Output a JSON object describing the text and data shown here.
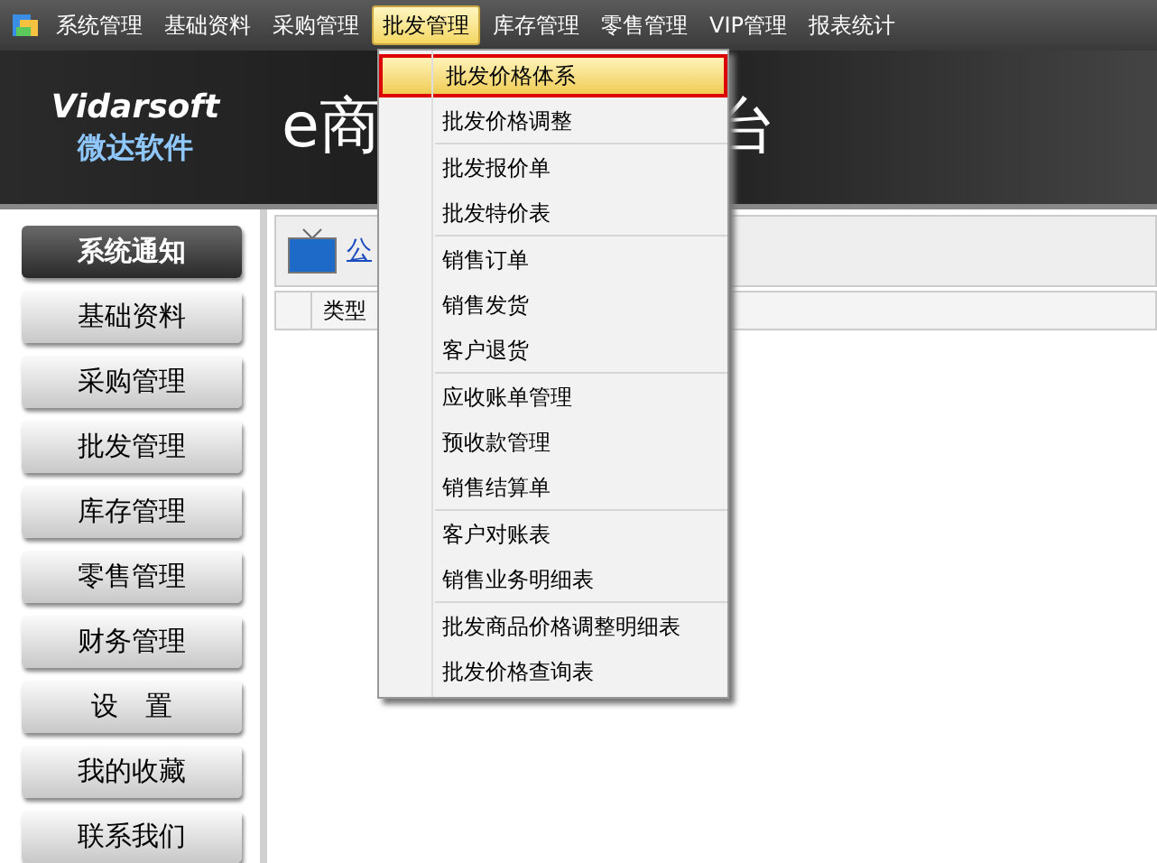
{
  "menubar": [
    {
      "label": "系统管理",
      "selected": false
    },
    {
      "label": "基础资料",
      "selected": false
    },
    {
      "label": "采购管理",
      "selected": false
    },
    {
      "label": "批发管理",
      "selected": true
    },
    {
      "label": "库存管理",
      "selected": false
    },
    {
      "label": "零售管理",
      "selected": false
    },
    {
      "label": "VIP管理",
      "selected": false
    },
    {
      "label": "报表统计",
      "selected": false
    }
  ],
  "banner": {
    "logo_text": "Vidarsoft",
    "logo_subtitle": "微达软件",
    "title_start": "e商",
    "title_end": "台"
  },
  "sidebar": [
    {
      "label": "系统通知",
      "selected": true
    },
    {
      "label": "基础资料",
      "selected": false
    },
    {
      "label": "采购管理",
      "selected": false
    },
    {
      "label": "批发管理",
      "selected": false
    },
    {
      "label": "库存管理",
      "selected": false
    },
    {
      "label": "零售管理",
      "selected": false
    },
    {
      "label": "财务管理",
      "selected": false
    },
    {
      "label": "设　置",
      "selected": false
    },
    {
      "label": "我的收藏",
      "selected": false
    },
    {
      "label": "联系我们",
      "selected": false
    }
  ],
  "content": {
    "tab_label": "公",
    "table": {
      "columns": [
        "类型"
      ]
    }
  },
  "dropdown": [
    [
      {
        "label": "批发价格体系",
        "selected": true
      },
      {
        "label": "批发价格调整",
        "selected": false
      }
    ],
    [
      {
        "label": "批发报价单",
        "selected": false
      },
      {
        "label": "批发特价表",
        "selected": false
      }
    ],
    [
      {
        "label": "销售订单",
        "selected": false
      },
      {
        "label": "销售发货",
        "selected": false
      },
      {
        "label": "客户退货",
        "selected": false
      }
    ],
    [
      {
        "label": "应收账单管理",
        "selected": false
      },
      {
        "label": "预收款管理",
        "selected": false
      },
      {
        "label": "销售结算单",
        "selected": false
      }
    ],
    [
      {
        "label": "客户对账表",
        "selected": false
      },
      {
        "label": "销售业务明细表",
        "selected": false
      }
    ],
    [
      {
        "label": "批发商品价格调整明细表",
        "selected": false
      },
      {
        "label": "批发价格查询表",
        "selected": false
      }
    ]
  ]
}
